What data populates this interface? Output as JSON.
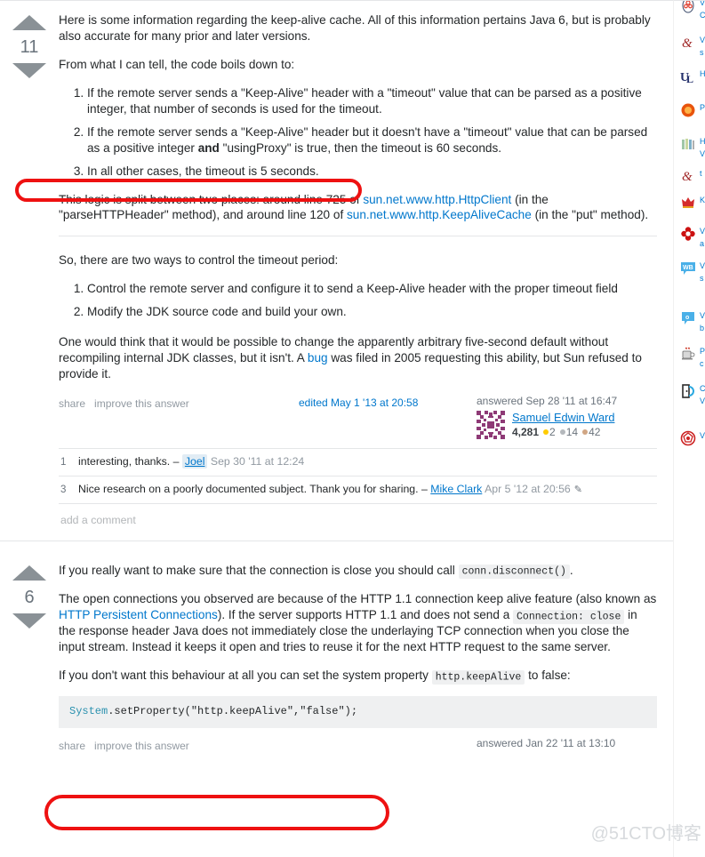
{
  "answers": [
    {
      "id": "answer-1",
      "votes": "11",
      "paragraphs": {
        "p1_a": "Here is some information regarding the keep-alive cache. All of this information pertains Java 6, but is probably also accurate for many prior and later versions.",
        "p2": "From what I can tell, the code boils down to:",
        "list1": [
          "If the remote server sends a \"Keep-Alive\" header with a \"timeout\" value that can be parsed as a positive integer, that number of seconds is used for the timeout.",
          "If the remote server sends a \"Keep-Alive\" header but it doesn't have a \"timeout\" value that can be parsed as a positive integer and \"usingProxy\" is true, then the timeout is 60 seconds.",
          "In all other cases, the timeout is 5 seconds."
        ],
        "p3_part1": "This logic is split between two places: around line 725 of ",
        "p3_link1": "sun.net.www.http.HttpClient",
        "p3_part2": " (in the \"parseHTTPHeader\" method), and around line 120 of ",
        "p3_link2": "sun.net.www.http.KeepAliveCache",
        "p3_part3": " (in the \"put\" method).",
        "p4": "So, there are two ways to control the timeout period:",
        "list2": [
          "Control the remote server and configure it to send a Keep-Alive header with the proper timeout field",
          "Modify the JDK source code and build your own."
        ],
        "p5_part1": "One would think that it would be possible to change the apparently arbitrary five-second default without recompiling internal JDK classes, but it isn't. A ",
        "p5_link": "bug",
        "p5_part2": " was filed in 2005 requesting this ability, but Sun refused to provide it."
      },
      "meta": {
        "share": "share",
        "improve": "improve this answer",
        "edited": "edited May 1 '13 at 20:58",
        "answered": "answered Sep 28 '11 at 16:47",
        "username": "Samuel Edwin Ward",
        "reputation": "4,281",
        "gold": "2",
        "silver": "14",
        "bronze": "42"
      },
      "comments": [
        {
          "score": "1",
          "text": "interesting, thanks.",
          "dash": "–",
          "user": "Joel",
          "user_highlight": true,
          "time": "Sep 30 '11 at 12:24",
          "pencil": false
        },
        {
          "score": "3",
          "text": "Nice research on a poorly documented subject. Thank you for sharing.",
          "dash": "–",
          "user": "Mike Clark",
          "user_highlight": false,
          "time": "Apr 5 '12 at 20:56",
          "pencil": true
        }
      ],
      "add_comment": "add a comment"
    },
    {
      "id": "answer-2",
      "votes": "6",
      "paragraphs": {
        "p1_part1": "If you really want to make sure that the connection is close you should call ",
        "p1_code": "conn.disconnect()",
        "p1_part2": ".",
        "p2_part1": "The open connections you observed are because of the HTTP 1.1 connection keep alive feature (also known as ",
        "p2_link": "HTTP Persistent Connections",
        "p2_part2": "). If the server supports HTTP 1.1 and does not send a ",
        "p2_code": "Connection: close",
        "p2_part3": " in the response header Java does not immediately close the underlaying TCP connection when you close the input stream. Instead it keeps it open and tries to reuse it for the next HTTP request to the same server.",
        "p3_part1": "If you don't want this behaviour at all you can set the system property ",
        "p3_code": "http.keepAlive",
        "p3_part2": " to false:",
        "code_keyword": "System",
        "code_rest": ".setProperty(\"http.keepAlive\",\"false\");"
      },
      "meta": {
        "share": "share",
        "improve": "improve this answer",
        "answered": "answered Jan 22 '11 at 13:10"
      }
    }
  ],
  "sidebar": {
    "items": [
      {
        "icon": "atom-icon",
        "color": "#d9534f",
        "line1": "V",
        "line2": "C"
      },
      {
        "icon": "ampersand-icon",
        "color": "#b03030",
        "line1": "V",
        "line2": "s"
      },
      {
        "icon": "ul-logo-icon",
        "color": "#2b3a6b",
        "line1": "H",
        "line2": ""
      },
      {
        "icon": "orange-burst-icon",
        "color": "#f06a10",
        "line1": "P",
        "line2": ""
      },
      {
        "icon": "books-icon",
        "color": "#8fbf9f",
        "line1": "H",
        "line2": "V"
      },
      {
        "icon": "ampersand-icon",
        "color": "#b03030",
        "line1": "t",
        "line2": ""
      },
      {
        "icon": "crown-icon",
        "color": "#c8102e",
        "line1": "K",
        "line2": ""
      },
      {
        "icon": "red-flower-icon",
        "color": "#cc0000",
        "line1": "V",
        "line2": "a"
      },
      {
        "icon": "wb-bubble-icon",
        "color": "#54b4eb",
        "line1": "V",
        "line2": "s"
      },
      {
        "icon": "o-bubble-icon",
        "color": "#54b4eb",
        "line1": "V",
        "line2": "b"
      },
      {
        "icon": "coffee-cup-icon",
        "color": "#8a6a5a",
        "line1": "P",
        "line2": "c"
      },
      {
        "icon": "door-open-icon",
        "color": "#2aa8e0",
        "line1": "C",
        "line2": "V"
      },
      {
        "icon": "red-gem-icon",
        "color": "#cc2222",
        "line1": "V",
        "line2": ""
      }
    ]
  },
  "watermark": {
    "text": "@51CTO博客"
  },
  "annotations": {
    "oval1_target": "In all other cases, the timeout is 5 seconds.",
    "oval2_target": "System.setProperty(\"http.keepAlive\",\"false\");"
  }
}
